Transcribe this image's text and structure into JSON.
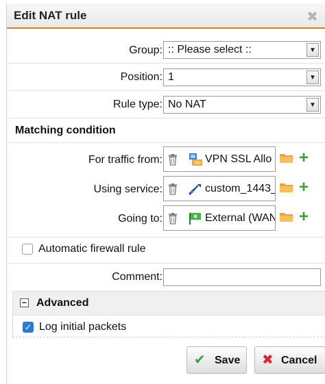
{
  "dialog": {
    "title": "Edit NAT rule",
    "close_icon": "close-icon"
  },
  "form": {
    "group": {
      "label": "Group:",
      "value": ":: Please select ::"
    },
    "position": {
      "label": "Position:",
      "value": "1"
    },
    "rule_type": {
      "label": "Rule type:",
      "value": "No NAT"
    }
  },
  "matching": {
    "title": "Matching condition",
    "traffic_from": {
      "label": "For traffic from:",
      "value": "VPN SSL Allo",
      "icon": "vpn-network-icon"
    },
    "using_service": {
      "label": "Using service:",
      "value": "custom_1443_",
      "icon": "service-icon"
    },
    "going_to": {
      "label": "Going to:",
      "value": "External (WAN",
      "icon": "interface-flag-icon"
    }
  },
  "auto_firewall": {
    "label": "Automatic firewall rule",
    "checked": false
  },
  "comment": {
    "label": "Comment:",
    "value": ""
  },
  "advanced": {
    "title": "Advanced",
    "log_initial": {
      "label": "Log initial packets",
      "checked": true
    }
  },
  "buttons": {
    "save": "Save",
    "cancel": "Cancel"
  },
  "colors": {
    "accent": "#e07a1a",
    "save_icon": "#3aa13a",
    "cancel_icon": "#d6282e",
    "checkbox_checked": "#2f79d6"
  }
}
